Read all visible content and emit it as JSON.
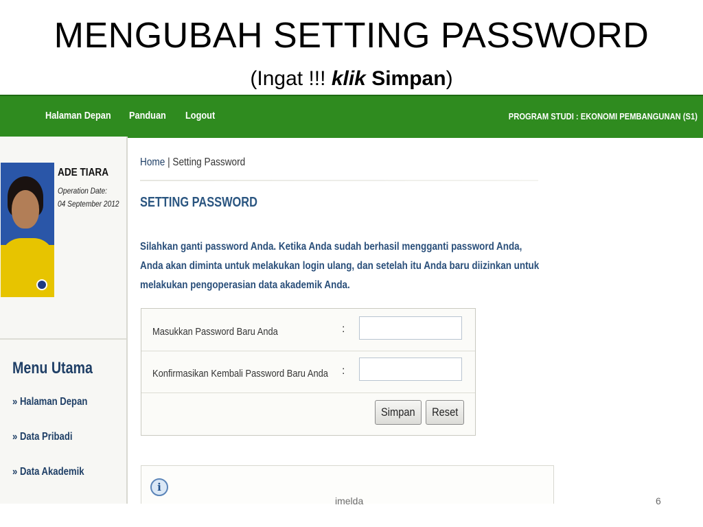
{
  "slide": {
    "title": "MENGUBAH SETTING PASSWORD",
    "subtitle_open": "(Ingat !!! ",
    "subtitle_klik": "klik",
    "subtitle_space": " ",
    "subtitle_simpan": "Simpan",
    "subtitle_close": ")",
    "footer_author": "imelda",
    "footer_page": "6"
  },
  "topbar": {
    "nav": [
      "Halaman Depan",
      "Panduan",
      "Logout"
    ],
    "program": "PROGRAM STUDI : EKONOMI PEMBANGUNAN (S1)",
    "color": "#2f8b1f"
  },
  "user": {
    "name": "ADE TIARA",
    "op_label": "Operation Date:",
    "op_date": "04 September 2012"
  },
  "menu": {
    "title": "Menu Utama",
    "items": [
      "» Halaman Depan",
      "» Data Pribadi",
      "» Data Akademik"
    ]
  },
  "breadcrumb": {
    "home": "Home",
    "sep": " | ",
    "current": "Setting Password"
  },
  "page": {
    "section_title": "SETTING PASSWORD",
    "instructions": "Silahkan ganti password Anda. Ketika Anda sudah berhasil mengganti password Anda, Anda akan diminta untuk melakukan login ulang, dan setelah itu Anda baru diizinkan untuk melakukan pengoperasian data akademik Anda."
  },
  "form": {
    "new_password_label": "Masukkan Password Baru Anda",
    "confirm_label": "Konfirmasikan Kembali Password Baru Anda",
    "colon": ":",
    "save_label": "Simpan",
    "reset_label": "Reset"
  },
  "icons": {
    "info": "info-icon"
  }
}
